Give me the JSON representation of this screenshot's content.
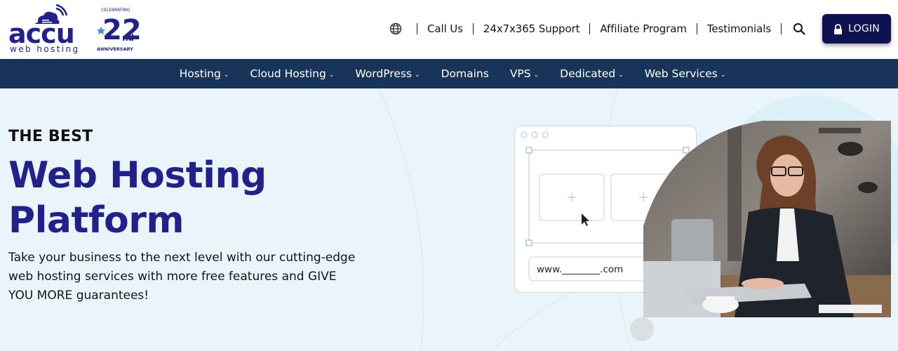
{
  "header": {
    "logo": {
      "brand": "accu",
      "tagline": "web hosting",
      "badge_top": "CELEBRATING",
      "badge_number": "22",
      "badge_suffix": "nd",
      "badge_bottom": "ANNIVERSARY"
    },
    "links": [
      "Call Us",
      "24x7x365 Support",
      "Affiliate Program",
      "Testimonials"
    ],
    "login_label": "LOGIN"
  },
  "nav": [
    {
      "label": "Hosting",
      "dropdown": true
    },
    {
      "label": "Cloud Hosting",
      "dropdown": true
    },
    {
      "label": "WordPress",
      "dropdown": true
    },
    {
      "label": "Domains",
      "dropdown": false
    },
    {
      "label": "VPS",
      "dropdown": true
    },
    {
      "label": "Dedicated",
      "dropdown": true
    },
    {
      "label": "Web Services",
      "dropdown": true
    }
  ],
  "hero": {
    "kicker": "THE BEST",
    "headline_line1": "Web Hosting",
    "headline_line2": "Platform",
    "subtext": "Take your business to the next level with our cutting-edge web hosting services with more free features and GIVE YOU MORE guarantees!",
    "domain_field": "www.________.com"
  },
  "colors": {
    "brand_navy": "#22218c",
    "nav_bg": "#183459",
    "login_bg": "#0e1250",
    "hero_bg": "#eaf5fb"
  },
  "icons": {
    "language": "globe-icon",
    "search": "search-icon",
    "login": "lock-icon",
    "caret": "chevron-down-icon"
  }
}
